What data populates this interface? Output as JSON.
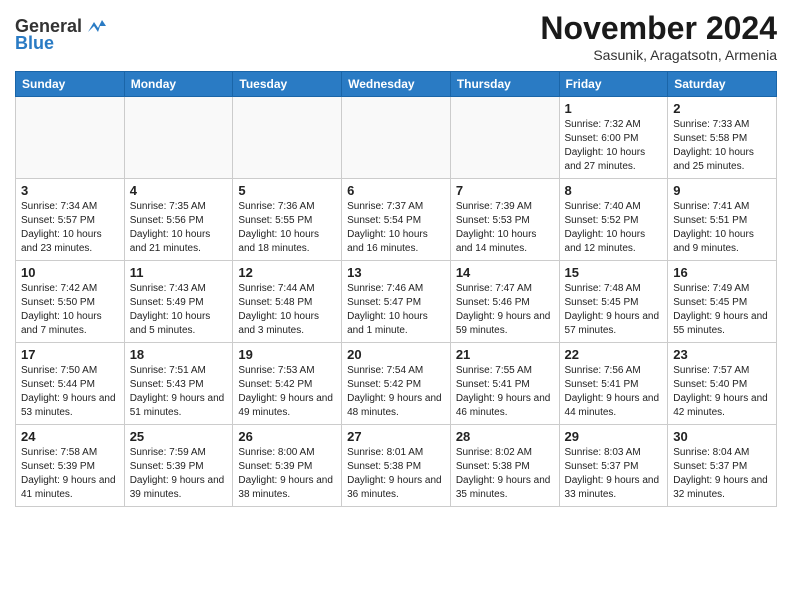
{
  "header": {
    "logo_general": "General",
    "logo_blue": "Blue",
    "month_title": "November 2024",
    "location": "Sasunik, Aragatsotn, Armenia"
  },
  "calendar": {
    "days_of_week": [
      "Sunday",
      "Monday",
      "Tuesday",
      "Wednesday",
      "Thursday",
      "Friday",
      "Saturday"
    ],
    "weeks": [
      [
        {
          "day": "",
          "info": ""
        },
        {
          "day": "",
          "info": ""
        },
        {
          "day": "",
          "info": ""
        },
        {
          "day": "",
          "info": ""
        },
        {
          "day": "",
          "info": ""
        },
        {
          "day": "1",
          "info": "Sunrise: 7:32 AM\nSunset: 6:00 PM\nDaylight: 10 hours and 27 minutes."
        },
        {
          "day": "2",
          "info": "Sunrise: 7:33 AM\nSunset: 5:58 PM\nDaylight: 10 hours and 25 minutes."
        }
      ],
      [
        {
          "day": "3",
          "info": "Sunrise: 7:34 AM\nSunset: 5:57 PM\nDaylight: 10 hours and 23 minutes."
        },
        {
          "day": "4",
          "info": "Sunrise: 7:35 AM\nSunset: 5:56 PM\nDaylight: 10 hours and 21 minutes."
        },
        {
          "day": "5",
          "info": "Sunrise: 7:36 AM\nSunset: 5:55 PM\nDaylight: 10 hours and 18 minutes."
        },
        {
          "day": "6",
          "info": "Sunrise: 7:37 AM\nSunset: 5:54 PM\nDaylight: 10 hours and 16 minutes."
        },
        {
          "day": "7",
          "info": "Sunrise: 7:39 AM\nSunset: 5:53 PM\nDaylight: 10 hours and 14 minutes."
        },
        {
          "day": "8",
          "info": "Sunrise: 7:40 AM\nSunset: 5:52 PM\nDaylight: 10 hours and 12 minutes."
        },
        {
          "day": "9",
          "info": "Sunrise: 7:41 AM\nSunset: 5:51 PM\nDaylight: 10 hours and 9 minutes."
        }
      ],
      [
        {
          "day": "10",
          "info": "Sunrise: 7:42 AM\nSunset: 5:50 PM\nDaylight: 10 hours and 7 minutes."
        },
        {
          "day": "11",
          "info": "Sunrise: 7:43 AM\nSunset: 5:49 PM\nDaylight: 10 hours and 5 minutes."
        },
        {
          "day": "12",
          "info": "Sunrise: 7:44 AM\nSunset: 5:48 PM\nDaylight: 10 hours and 3 minutes."
        },
        {
          "day": "13",
          "info": "Sunrise: 7:46 AM\nSunset: 5:47 PM\nDaylight: 10 hours and 1 minute."
        },
        {
          "day": "14",
          "info": "Sunrise: 7:47 AM\nSunset: 5:46 PM\nDaylight: 9 hours and 59 minutes."
        },
        {
          "day": "15",
          "info": "Sunrise: 7:48 AM\nSunset: 5:45 PM\nDaylight: 9 hours and 57 minutes."
        },
        {
          "day": "16",
          "info": "Sunrise: 7:49 AM\nSunset: 5:45 PM\nDaylight: 9 hours and 55 minutes."
        }
      ],
      [
        {
          "day": "17",
          "info": "Sunrise: 7:50 AM\nSunset: 5:44 PM\nDaylight: 9 hours and 53 minutes."
        },
        {
          "day": "18",
          "info": "Sunrise: 7:51 AM\nSunset: 5:43 PM\nDaylight: 9 hours and 51 minutes."
        },
        {
          "day": "19",
          "info": "Sunrise: 7:53 AM\nSunset: 5:42 PM\nDaylight: 9 hours and 49 minutes."
        },
        {
          "day": "20",
          "info": "Sunrise: 7:54 AM\nSunset: 5:42 PM\nDaylight: 9 hours and 48 minutes."
        },
        {
          "day": "21",
          "info": "Sunrise: 7:55 AM\nSunset: 5:41 PM\nDaylight: 9 hours and 46 minutes."
        },
        {
          "day": "22",
          "info": "Sunrise: 7:56 AM\nSunset: 5:41 PM\nDaylight: 9 hours and 44 minutes."
        },
        {
          "day": "23",
          "info": "Sunrise: 7:57 AM\nSunset: 5:40 PM\nDaylight: 9 hours and 42 minutes."
        }
      ],
      [
        {
          "day": "24",
          "info": "Sunrise: 7:58 AM\nSunset: 5:39 PM\nDaylight: 9 hours and 41 minutes."
        },
        {
          "day": "25",
          "info": "Sunrise: 7:59 AM\nSunset: 5:39 PM\nDaylight: 9 hours and 39 minutes."
        },
        {
          "day": "26",
          "info": "Sunrise: 8:00 AM\nSunset: 5:39 PM\nDaylight: 9 hours and 38 minutes."
        },
        {
          "day": "27",
          "info": "Sunrise: 8:01 AM\nSunset: 5:38 PM\nDaylight: 9 hours and 36 minutes."
        },
        {
          "day": "28",
          "info": "Sunrise: 8:02 AM\nSunset: 5:38 PM\nDaylight: 9 hours and 35 minutes."
        },
        {
          "day": "29",
          "info": "Sunrise: 8:03 AM\nSunset: 5:37 PM\nDaylight: 9 hours and 33 minutes."
        },
        {
          "day": "30",
          "info": "Sunrise: 8:04 AM\nSunset: 5:37 PM\nDaylight: 9 hours and 32 minutes."
        }
      ]
    ]
  }
}
